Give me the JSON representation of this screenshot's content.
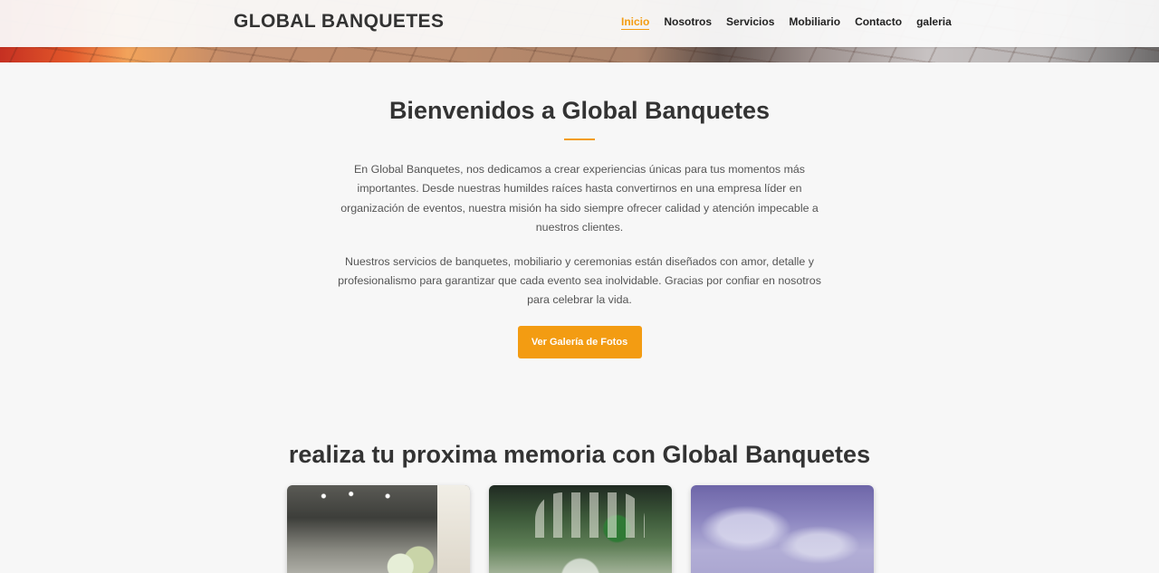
{
  "brand": "GLOBAL BANQUETES",
  "nav": {
    "items": [
      {
        "label": "Inicio",
        "active": true
      },
      {
        "label": "Nosotros",
        "active": false
      },
      {
        "label": "Servicios",
        "active": false
      },
      {
        "label": "Mobiliario",
        "active": false
      },
      {
        "label": "Contacto",
        "active": false
      },
      {
        "label": "galeria",
        "active": false
      }
    ]
  },
  "welcome": {
    "title": "Bienvenidos a Global Banquetes",
    "paragraph1": "En Global Banquetes, nos dedicamos a crear experiencias únicas para tus momentos más importantes. Desde nuestras humildes raíces hasta convertirnos en una empresa líder en organización de eventos, nuestra misión ha sido siempre ofrecer calidad y atención impecable a nuestros clientes.",
    "paragraph2": "Nuestros servicios de banquetes, mobiliario y ceremonias están diseñados con amor, detalle y profesionalismo para garantizar que cada evento sea inolvidable. Gracias por confiar en nosotros para celebrar la vida.",
    "button_label": "Ver Galería de Fotos"
  },
  "memory": {
    "title": "realiza tu proxima memoria con Global Banquetes"
  },
  "colors": {
    "accent": "#f39c12",
    "text": "#333333",
    "background": "#f7f7f7"
  }
}
